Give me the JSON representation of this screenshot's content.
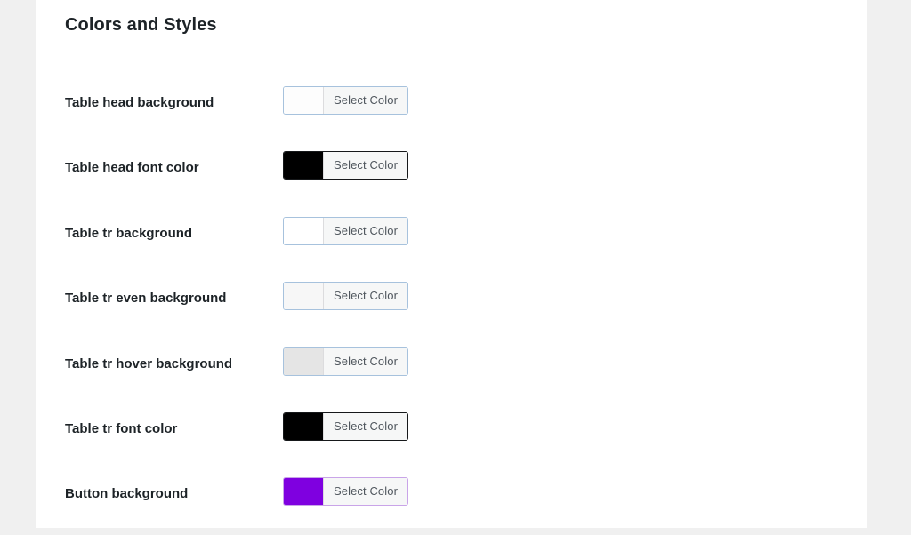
{
  "page": {
    "background_color": "#f0f0f0",
    "card_background_color": "#ffffff"
  },
  "section": {
    "title": "Colors and Styles"
  },
  "common": {
    "select_color_label": "Select Color"
  },
  "settings": {
    "rows": [
      {
        "label": "Table head background",
        "button_label": "Select Color",
        "swatch_color": "#fdfdfd",
        "border_color": "#a7c2dd",
        "border_style": "light"
      },
      {
        "label": "Table head font color",
        "button_label": "Select Color",
        "swatch_color": "#000000",
        "border_color": "#16181a",
        "border_style": "dark"
      },
      {
        "label": "Table tr background",
        "button_label": "Select Color",
        "swatch_color": "#ffffff",
        "border_color": "#a7c2dd",
        "border_style": "light"
      },
      {
        "label": "Table tr even background",
        "button_label": "Select Color",
        "swatch_color": "#f7f7f7",
        "border_color": "#a7c2dd",
        "border_style": "light"
      },
      {
        "label": "Table tr hover background",
        "button_label": "Select Color",
        "swatch_color": "#e5e5e5",
        "border_color": "#a7c2dd",
        "border_style": "light"
      },
      {
        "label": "Table tr font color",
        "button_label": "Select Color",
        "swatch_color": "#000000",
        "border_color": "#16181a",
        "border_style": "dark"
      },
      {
        "label": "Button background",
        "button_label": "Select Color",
        "swatch_color": "#7f00e0",
        "border_color": "#c9a4e8",
        "border_style": "purple"
      }
    ]
  }
}
